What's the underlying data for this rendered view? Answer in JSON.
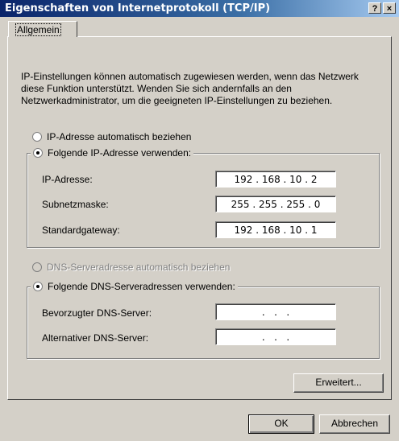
{
  "window": {
    "title": "Eigenschaften von Internetprotokoll (TCP/IP)",
    "help_button": "?",
    "close_button": "×"
  },
  "tabs": [
    {
      "label": "Allgemein",
      "active": true
    }
  ],
  "description": "IP-Einstellungen können automatisch zugewiesen werden, wenn das Netzwerk diese Funktion unterstützt. Wenden Sie sich andernfalls an den Netzwerkadministrator, um die geeigneten IP-Einstellungen zu beziehen.",
  "ip_settings": {
    "auto_label": "IP-Adresse automatisch beziehen",
    "manual_label": "Folgende IP-Adresse verwenden:",
    "selected": "manual",
    "fields": [
      {
        "label": "IP-Adresse:",
        "value": "192 . 168 . 10 . 2"
      },
      {
        "label": "Subnetzmaske:",
        "value": "255 . 255 . 255 . 0"
      },
      {
        "label": "Standardgateway:",
        "value": "192 . 168 . 10 . 1"
      }
    ]
  },
  "dns_settings": {
    "auto_label": "DNS-Serveradresse automatisch beziehen",
    "manual_label": "Folgende DNS-Serveradressen verwenden:",
    "selected": "manual",
    "fields": [
      {
        "label": "Bevorzugter DNS-Server:",
        "value": ".   .   ."
      },
      {
        "label": "Alternativer DNS-Server:",
        "value": ".   .   ."
      }
    ]
  },
  "buttons": {
    "advanced": "Erweitert...",
    "ok": "OK",
    "cancel": "Abbrechen"
  }
}
